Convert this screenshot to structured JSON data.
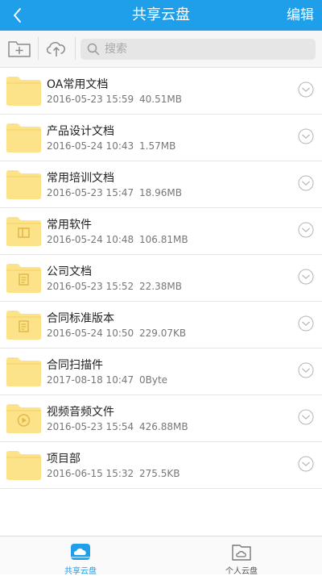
{
  "header": {
    "title": "共享云盘",
    "edit_label": "编辑"
  },
  "toolbar": {
    "new_folder_icon": "new-folder-icon",
    "upload_icon": "cloud-upload-icon"
  },
  "search": {
    "placeholder": "搜索",
    "value": ""
  },
  "files": [
    {
      "name": "OA常用文档",
      "date": "2016-05-23 15:59",
      "size": "40.51MB",
      "icon": "folder"
    },
    {
      "name": "产品设计文档",
      "date": "2016-05-24 10:43",
      "size": "1.57MB",
      "icon": "folder"
    },
    {
      "name": "常用培训文档",
      "date": "2016-05-23 15:47",
      "size": "18.96MB",
      "icon": "folder"
    },
    {
      "name": "常用软件",
      "date": "2016-05-24 10:48",
      "size": "106.81MB",
      "icon": "folder-app"
    },
    {
      "name": "公司文档",
      "date": "2016-05-23 15:52",
      "size": "22.38MB",
      "icon": "folder-doc"
    },
    {
      "name": "合同标准版本",
      "date": "2016-05-24 10:50",
      "size": "229.07KB",
      "icon": "folder-doc"
    },
    {
      "name": "合同扫描件",
      "date": "2017-08-18 10:47",
      "size": "0Byte",
      "icon": "folder"
    },
    {
      "name": "视频音频文件",
      "date": "2016-05-23 15:54",
      "size": "426.88MB",
      "icon": "folder-video"
    },
    {
      "name": "项目部",
      "date": "2016-06-15 15:32",
      "size": "275.5KB",
      "icon": "folder"
    }
  ],
  "bottom_nav": [
    {
      "label": "共享云盘",
      "icon": "shared-cloud-disk-icon",
      "active": true
    },
    {
      "label": "个人云盘",
      "icon": "personal-cloud-disk-icon",
      "active": false
    }
  ],
  "colors": {
    "primary": "#1f9fe9",
    "folder": "#fce38a",
    "folder_dark": "#f3cf63"
  }
}
